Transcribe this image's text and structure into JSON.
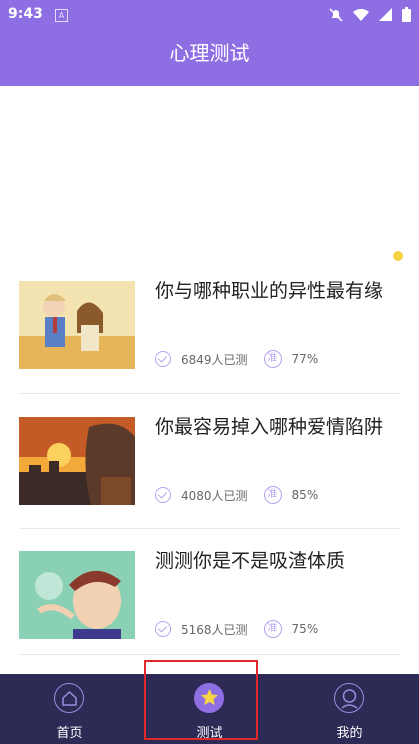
{
  "status": {
    "time": "9:43",
    "app_badge": "A"
  },
  "header": {
    "title": "心理测试"
  },
  "tests": [
    {
      "title": "你与哪种职业的异性最有缘",
      "count": "6849人已测",
      "accuracy_badge": "准",
      "accuracy": "77%",
      "thumb_colors": [
        "#f3e3b0",
        "#5a7ec4",
        "#b33d39"
      ]
    },
    {
      "title": "你最容易掉入哪种爱情陷阱",
      "count": "4080人已测",
      "accuracy_badge": "准",
      "accuracy": "85%",
      "thumb_colors": [
        "#c45a25",
        "#f3a83b",
        "#5b3a2a"
      ]
    },
    {
      "title": "测测你是不是吸渣体质",
      "count": "5168人已测",
      "accuracy_badge": "准",
      "accuracy": "75%",
      "thumb_colors": [
        "#8ad0b5",
        "#f2d1b2",
        "#3e3b8f"
      ]
    }
  ],
  "tabs": [
    {
      "label": "首页",
      "icon": "home-icon"
    },
    {
      "label": "测试",
      "icon": "star-icon",
      "active": true
    },
    {
      "label": "我的",
      "icon": "profile-icon"
    }
  ],
  "colors": {
    "primary": "#8e6fe3",
    "tabbar": "#2e2a56",
    "accent_yellow": "#f5d445"
  }
}
